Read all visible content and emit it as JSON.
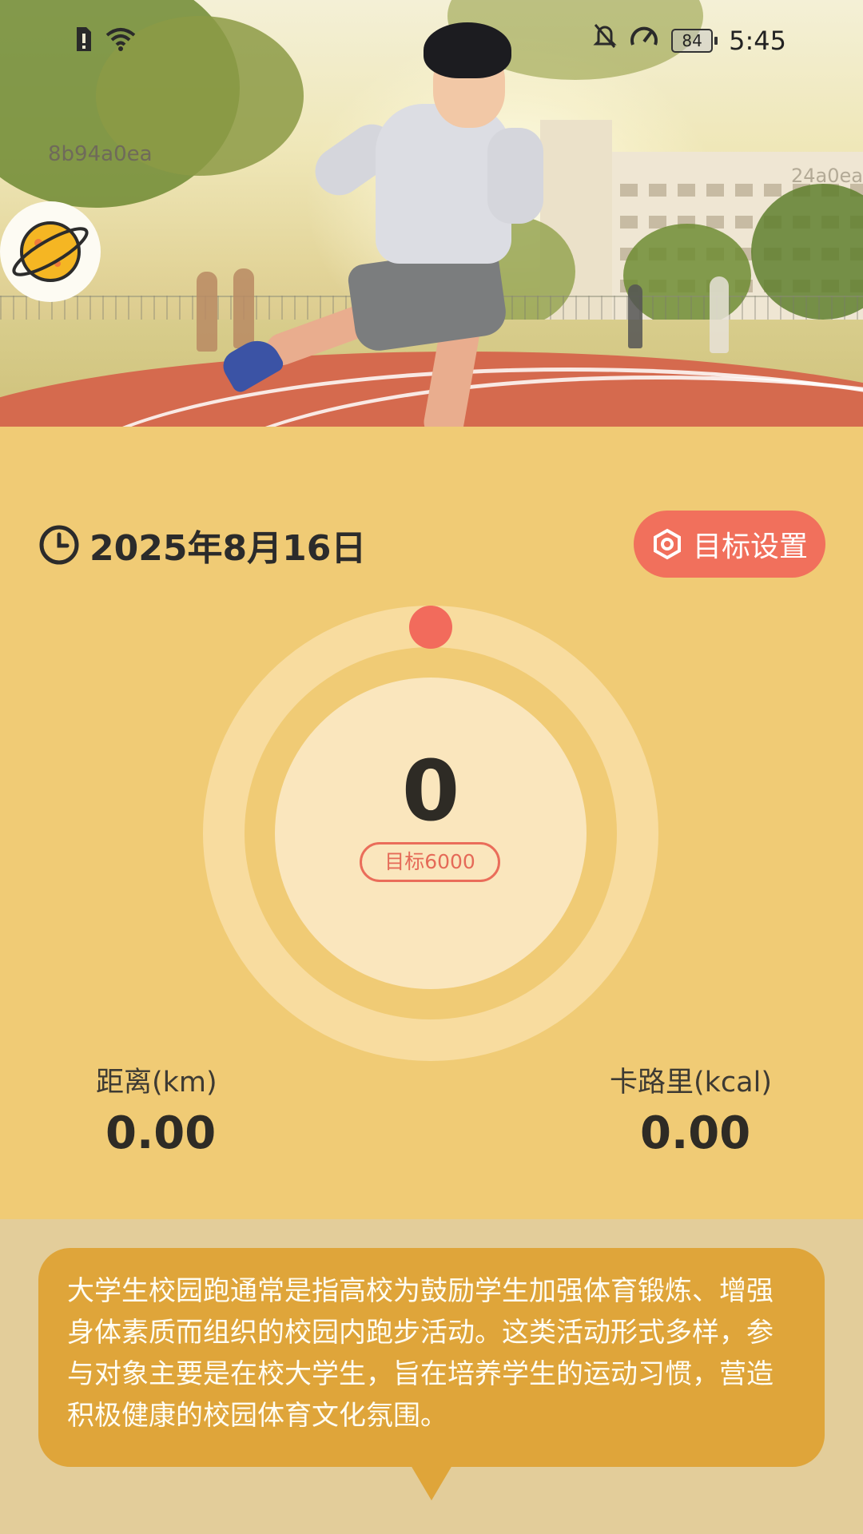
{
  "status_bar": {
    "time": "5:45",
    "battery_level": "84",
    "icons": [
      "sim-alert-icon",
      "wifi-icon",
      "bell-off-icon",
      "speed-icon",
      "battery-icon"
    ]
  },
  "hero": {
    "code_left": "8b94a0ea",
    "code_right": "24a0ea"
  },
  "header": {
    "date": "2025年8月16日",
    "goal_button_label": "目标设置"
  },
  "progress": {
    "steps": "0",
    "goal_label": "目标6000",
    "fraction": 0
  },
  "stats": {
    "distance_label": "距离(km)",
    "distance_value": "0.00",
    "calories_label": "卡路里(kcal)",
    "calories_value": "0.00"
  },
  "info": {
    "text": "大学生校园跑通常是指高校为鼓励学生加强体育锻炼、增强身体素质而组织的校园内跑步活动。这类活动形式多样，参与对象主要是在校大学生，旨在培养学生的运动习惯，营造积极健康的校园体育文化氛围。"
  },
  "colors": {
    "background": "#f0cb75",
    "accent": "#f1705c",
    "bubble": "#dfa53a"
  }
}
